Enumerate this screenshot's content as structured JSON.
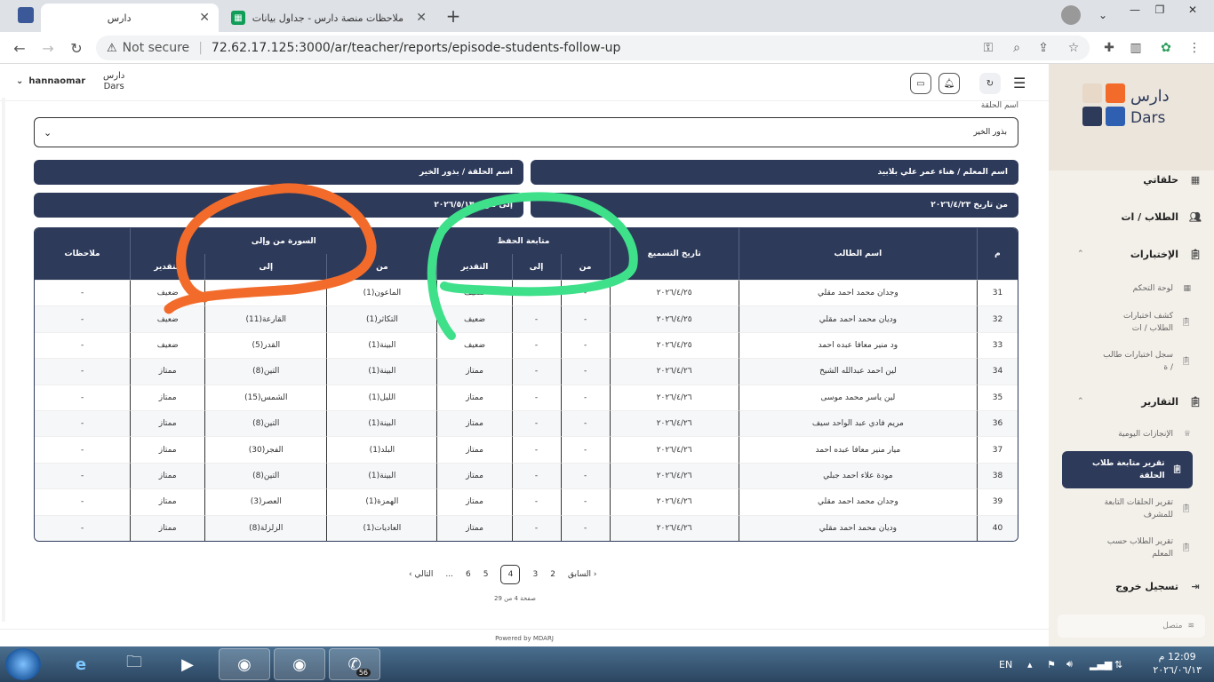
{
  "browser": {
    "tabs": [
      {
        "title": "دارس"
      },
      {
        "title": "ملاحظات منصة دارس - جداول بيانات Google"
      }
    ],
    "security_label": "Not secure",
    "url": "72.62.17.125:3000/ar/teacher/reports/episode-students-follow-up"
  },
  "header": {
    "username": "hannaomar",
    "logo_ar": "دارس",
    "logo_en": "Dars"
  },
  "filter": {
    "label": "اسم الحلقة",
    "selected": "بذور الخير"
  },
  "info": {
    "teacher": "اسم المعلم / هناء عمر علي بلابيد",
    "halqa": "اسم الحلقة / بذور الخير",
    "from_date": "من تاريخ ٢٠٢٦/٤/٢٣",
    "to_date": "إلى تاريخ ٢٠٢٦/٥/١٣"
  },
  "table": {
    "headers": {
      "num": "م",
      "student": "اسم الطالب",
      "date": "تاريخ التسميع",
      "hifz_group": "متابعة الحفظ",
      "hifz_from": "من",
      "hifz_to": "إلى",
      "hifz_grade": "التقدير",
      "surah_group": "السورة من وإلى",
      "surah_from": "من",
      "surah_to": "إلى",
      "surah_grade": "التقدير",
      "notes": "ملاحظات"
    },
    "rows": [
      {
        "num": "31",
        "name": "وجدان محمد احمد مقلي",
        "date": "٢٠٢٦/٤/٢٥",
        "hfrom": "-",
        "hto": "-",
        "hgrade": "ضعيف",
        "sfrom": "الماعون(1)",
        "sto": "الفيل(5)",
        "sgrade": "ضعيف",
        "notes": "-"
      },
      {
        "num": "32",
        "name": "وديان محمد احمد مقلي",
        "date": "٢٠٢٦/٤/٢٥",
        "hfrom": "-",
        "hto": "-",
        "hgrade": "ضعيف",
        "sfrom": "التكاثر(1)",
        "sto": "القارعة(11)",
        "sgrade": "ضعيف",
        "notes": "-"
      },
      {
        "num": "33",
        "name": "ود منير معافا عبده احمد",
        "date": "٢٠٢٦/٤/٢٥",
        "hfrom": "-",
        "hto": "-",
        "hgrade": "ضعيف",
        "sfrom": "البينة(1)",
        "sto": "القدر(5)",
        "sgrade": "ضعيف",
        "notes": "-"
      },
      {
        "num": "34",
        "name": "لين احمد عبدالله الشيخ",
        "date": "٢٠٢٦/٤/٢٦",
        "hfrom": "-",
        "hto": "-",
        "hgrade": "ممتاز",
        "sfrom": "البينة(1)",
        "sto": "التين(8)",
        "sgrade": "ممتاز",
        "notes": "-"
      },
      {
        "num": "35",
        "name": "لين ياسر محمد موسى",
        "date": "٢٠٢٦/٤/٢٦",
        "hfrom": "-",
        "hto": "-",
        "hgrade": "ممتاز",
        "sfrom": "الليل(1)",
        "sto": "الشمس(15)",
        "sgrade": "ممتاز",
        "notes": "-"
      },
      {
        "num": "36",
        "name": "مريم فادي عبد الواحد سيف",
        "date": "٢٠٢٦/٤/٢٦",
        "hfrom": "-",
        "hto": "-",
        "hgrade": "ممتاز",
        "sfrom": "البينة(1)",
        "sto": "التين(8)",
        "sgrade": "ممتاز",
        "notes": "-"
      },
      {
        "num": "37",
        "name": "ميار منير معافا عبده احمد",
        "date": "٢٠٢٦/٤/٢٦",
        "hfrom": "-",
        "hto": "-",
        "hgrade": "ممتاز",
        "sfrom": "البلد(1)",
        "sto": "الفجر(30)",
        "sgrade": "ممتاز",
        "notes": "-"
      },
      {
        "num": "38",
        "name": "مودة علاء احمد جبلي",
        "date": "٢٠٢٦/٤/٢٦",
        "hfrom": "-",
        "hto": "-",
        "hgrade": "ممتاز",
        "sfrom": "البينة(1)",
        "sto": "التين(8)",
        "sgrade": "ممتاز",
        "notes": "-"
      },
      {
        "num": "39",
        "name": "وجدان محمد احمد مقلي",
        "date": "٢٠٢٦/٤/٢٦",
        "hfrom": "-",
        "hto": "-",
        "hgrade": "ممتاز",
        "sfrom": "الهمزة(1)",
        "sto": "العصر(3)",
        "sgrade": "ممتاز",
        "notes": "-"
      },
      {
        "num": "40",
        "name": "وديان محمد احمد مقلي",
        "date": "٢٠٢٦/٤/٢٦",
        "hfrom": "-",
        "hto": "-",
        "hgrade": "ممتاز",
        "sfrom": "العاديات(1)",
        "sto": "الزلزلة(8)",
        "sgrade": "ممتاز",
        "notes": "-"
      }
    ]
  },
  "pagination": {
    "prev": "السابق",
    "next": "التالي",
    "pages": [
      "2",
      "3",
      "4",
      "5",
      "6",
      "..."
    ],
    "current": "4",
    "info": "صفحة 4 من 29"
  },
  "footer": "Powered by MDARJ",
  "sidebar": {
    "items": [
      {
        "label": "حلقاتي"
      },
      {
        "label": "الطلاب / ات"
      },
      {
        "label": "الإختبارات"
      },
      {
        "label": "لوحة التحكم"
      },
      {
        "label": "كشف اختبارات الطلاب / ات"
      },
      {
        "label": "سجل اختبارات طالب / ة"
      },
      {
        "label": "التقارير"
      },
      {
        "label": "الإنجازات اليومية"
      },
      {
        "label": "تقرير متابعة طلاب الحلقة"
      },
      {
        "label": "تقرير الحلقات التابعة للمشرف"
      },
      {
        "label": "تقرير الطلاب حسب المعلم"
      },
      {
        "label": "تسجيل خروج"
      }
    ],
    "status": "متصل"
  },
  "taskbar": {
    "lang": "EN",
    "badge": "56",
    "time": "12:09 م",
    "date": "٢٠٢٦/٠٦/١٣"
  },
  "colors": {
    "primary": "#2d3a5a",
    "annotation_orange": "#f26b2a",
    "annotation_green": "#3ee08a"
  }
}
